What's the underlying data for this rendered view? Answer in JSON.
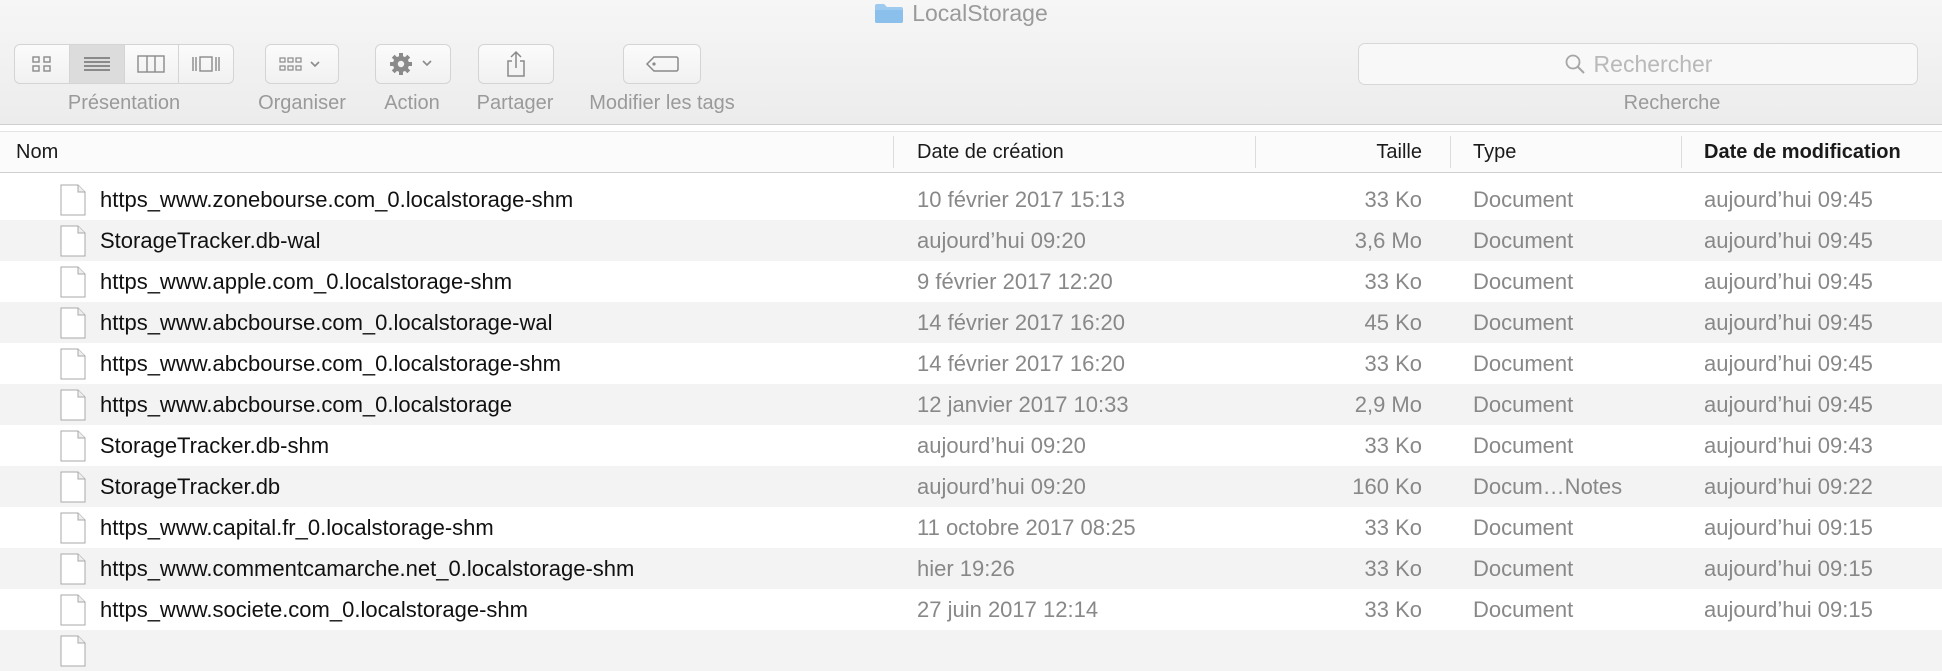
{
  "window": {
    "title": "LocalStorage"
  },
  "toolbar": {
    "view_label": "Présentation",
    "organize_label": "Organiser",
    "action_label": "Action",
    "share_label": "Partager",
    "tags_label": "Modifier les tags",
    "search_placeholder": "Rechercher",
    "search_label": "Recherche"
  },
  "columns": {
    "name": "Nom",
    "created": "Date de création",
    "size": "Taille",
    "type": "Type",
    "modified": "Date de modification"
  },
  "files": [
    {
      "name": "https_www.zonebourse.com_0.localstorage-shm",
      "created": "10 février 2017 15:13",
      "size": "33 Ko",
      "type": "Document",
      "modified": "aujourd’hui 09:45"
    },
    {
      "name": "StorageTracker.db-wal",
      "created": "aujourd’hui 09:20",
      "size": "3,6 Mo",
      "type": "Document",
      "modified": "aujourd’hui 09:45"
    },
    {
      "name": "https_www.apple.com_0.localstorage-shm",
      "created": "9 février 2017 12:20",
      "size": "33 Ko",
      "type": "Document",
      "modified": "aujourd’hui 09:45"
    },
    {
      "name": "https_www.abcbourse.com_0.localstorage-wal",
      "created": "14 février 2017 16:20",
      "size": "45 Ko",
      "type": "Document",
      "modified": "aujourd’hui 09:45"
    },
    {
      "name": "https_www.abcbourse.com_0.localstorage-shm",
      "created": "14 février 2017 16:20",
      "size": "33 Ko",
      "type": "Document",
      "modified": "aujourd’hui 09:45"
    },
    {
      "name": "https_www.abcbourse.com_0.localstorage",
      "created": "12 janvier 2017 10:33",
      "size": "2,9 Mo",
      "type": "Document",
      "modified": "aujourd’hui 09:45"
    },
    {
      "name": "StorageTracker.db-shm",
      "created": "aujourd’hui 09:20",
      "size": "33 Ko",
      "type": "Document",
      "modified": "aujourd’hui 09:43"
    },
    {
      "name": "StorageTracker.db",
      "created": "aujourd’hui 09:20",
      "size": "160 Ko",
      "type": "Docum…Notes",
      "modified": "aujourd’hui 09:22"
    },
    {
      "name": "https_www.capital.fr_0.localstorage-shm",
      "created": "11 octobre 2017 08:25",
      "size": "33 Ko",
      "type": "Document",
      "modified": "aujourd’hui 09:15"
    },
    {
      "name": "https_www.commentcamarche.net_0.localstorage-shm",
      "created": "hier 19:26",
      "size": "33 Ko",
      "type": "Document",
      "modified": "aujourd’hui 09:15"
    },
    {
      "name": "https_www.societe.com_0.localstorage-shm",
      "created": "27 juin 2017 12:14",
      "size": "33 Ko",
      "type": "Document",
      "modified": "aujourd’hui 09:15"
    }
  ]
}
